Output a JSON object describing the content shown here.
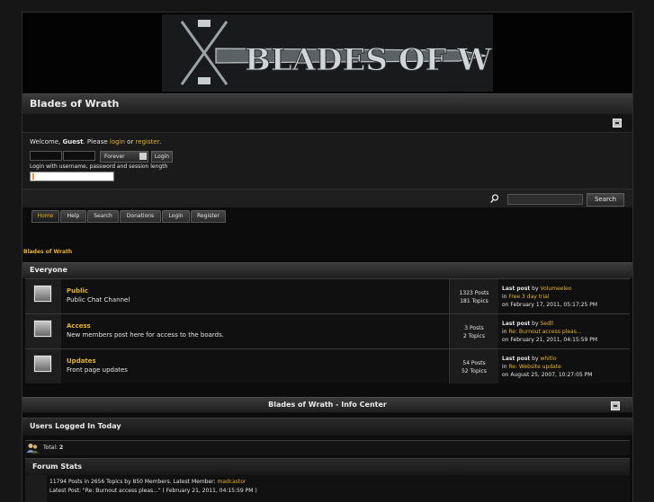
{
  "forum": {
    "title": "Blades of Wrath",
    "logo_text": "BLADES OF WRATH"
  },
  "login": {
    "welcome_prefix": "Welcome, ",
    "guest": "Guest",
    "please": ". Please ",
    "login_link": "login",
    "or": " or ",
    "register_link": "register",
    "period": ".",
    "duration_selected": "Forever",
    "login_button": "Login",
    "note": "Login with username, password and session length"
  },
  "search": {
    "button": "Search"
  },
  "menu": {
    "items": [
      {
        "label": "Home"
      },
      {
        "label": "Help"
      },
      {
        "label": "Search"
      },
      {
        "label": "Donations"
      },
      {
        "label": "Login"
      },
      {
        "label": "Register"
      }
    ]
  },
  "linktree": "Blades of Wrath",
  "category": {
    "name": "Everyone",
    "last_post_label": "Last post",
    "by": " by ",
    "in": "in ",
    "on": "on ",
    "boards": [
      {
        "name": "Public",
        "description": "Public Chat Channel",
        "posts": "1323 Posts",
        "topics": "181 Topics",
        "last_user": "Volumeeleo",
        "last_topic": "Free 3 day trial",
        "last_date": "February 17, 2011, 05:17:25 PM"
      },
      {
        "name": "Access",
        "description": "New members post here for access to the boards.",
        "posts": "3 Posts",
        "topics": "2 Topics",
        "last_user": "Sedll",
        "last_topic": "Re: Burnout access pleas...",
        "last_date": "February 21, 2011, 04:15:59 PM"
      },
      {
        "name": "Updates",
        "description": "Front page updates",
        "posts": "54 Posts",
        "topics": "52 Topics",
        "last_user": "whitlo",
        "last_topic": "Re: Website update",
        "last_date": "August 25, 2007, 10:27:05 PM"
      }
    ]
  },
  "info_center": {
    "title": "Blades of Wrath - Info Center",
    "users_today_title": "Users Logged In Today",
    "total_label": "Total: ",
    "total_value": "2",
    "stats_title": "Forum Stats",
    "stats_line1_prefix": "11794 Posts in 2656 Topics by 850 Members. Latest Member: ",
    "latest_member": "madcastor",
    "stats_line2": "Latest Post: \"Re: Burnout access pleas...\" ( February 21, 2011, 04:15:59 PM )"
  },
  "colors": {
    "accent": "#e4b41a",
    "background": "#0c0c0c",
    "text": "#d8d8d8"
  }
}
